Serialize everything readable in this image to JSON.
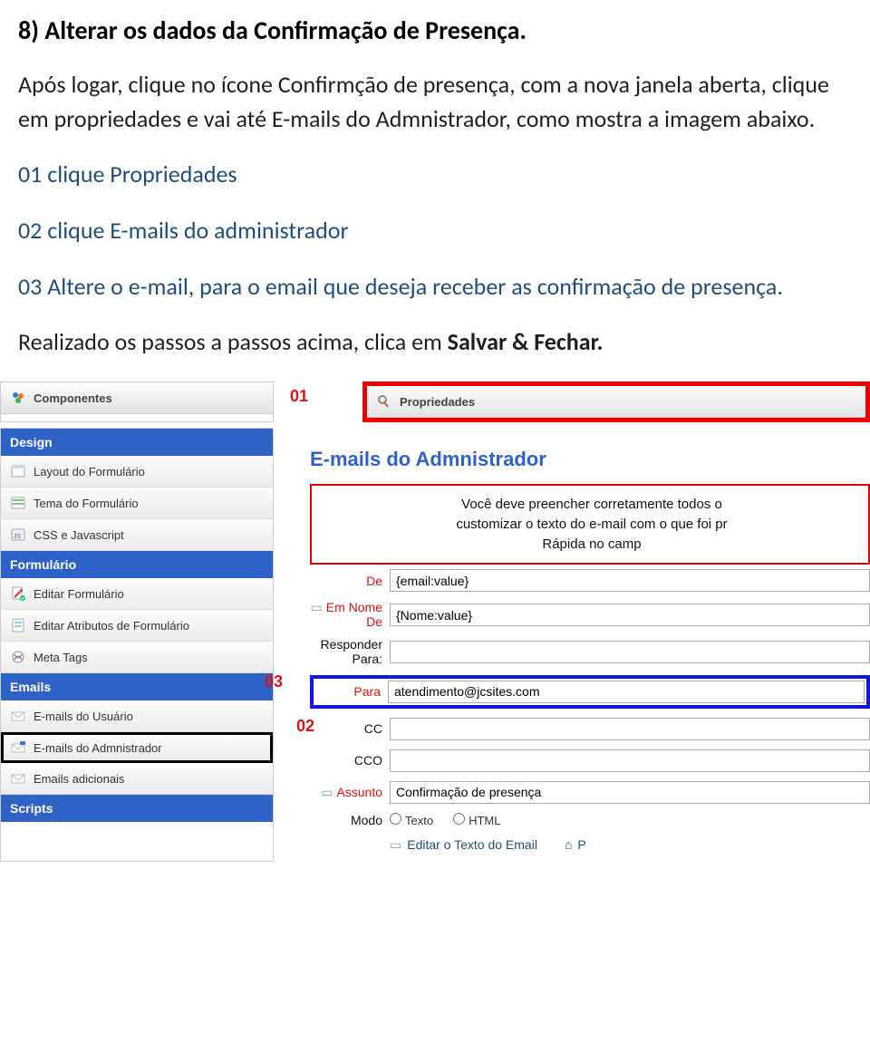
{
  "heading": "8) Alterar os dados da Confirmação de Presença.",
  "p1": "Após logar, clique no ícone Confirmção de presença, com a nova janela aberta, clique em propriedades e vai até E-mails do Admnistrador, como mostra a imagem abaixo.",
  "step01": "01 clique Propriedades",
  "step02": "02 clique E-mails do administrador",
  "step03": "03 Altere o e-mail, para o email que deseja receber as confirmação de presença.",
  "closing_a": "Realizado os passos a passos acima, clica em ",
  "closing_b": "Salvar & Fechar.",
  "screenshot": {
    "marker01": "01",
    "marker02": "02",
    "marker03": "03",
    "panels": {
      "componentes": "Componentes",
      "propriedades": "Propriedades",
      "design": "Design",
      "formulario": "Formulário",
      "emails": "Emails",
      "scripts": "Scripts"
    },
    "side_items": {
      "layout": "Layout do Formulário",
      "tema": "Tema do Formulário",
      "css": "CSS e Javascript",
      "editar_form": "Editar Formulário",
      "editar_attr": "Editar Atributos de Formulário",
      "meta": "Meta Tags",
      "emails_user": "E-mails do Usuário",
      "emails_admin": "E-mails do Admnistrador",
      "emails_add": "Emails adicionais"
    },
    "main": {
      "title": "E-mails do Admnistrador",
      "info_l1": "Você deve preencher corretamente todos o",
      "info_l2": "customizar o texto do e-mail com o que foi pr",
      "info_l3": "Rápida no camp",
      "labels": {
        "de": "De",
        "em_nome_de": "Em Nome De",
        "responder_para": "Responder Para:",
        "para": "Para",
        "cc": "CC",
        "cco": "CCO",
        "assunto": "Assunto",
        "modo": "Modo",
        "texto": "Texto",
        "html": "HTML",
        "editar_texto": "Editar o Texto do Email",
        "pi": "P"
      },
      "values": {
        "de": "{email:value}",
        "em_nome_de": "{Nome:value}",
        "responder_para": "",
        "para": "atendimento@jcsites.com",
        "cc": "",
        "cco": "",
        "assunto": "Confirmação de presença"
      }
    }
  }
}
